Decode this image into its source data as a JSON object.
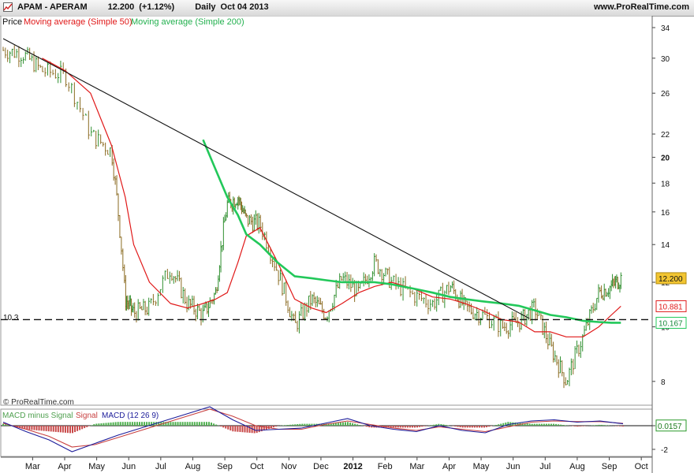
{
  "header": {
    "instrument": "APAM - APERAM",
    "last": "12.200",
    "change": "(+1.12%)",
    "period": "Daily",
    "date": "Oct 04 2013",
    "source": "www.ProRealTime.com"
  },
  "legend": {
    "price_label": "Price",
    "ma50_label": "Moving average (Simple 50)",
    "ma200_label": "Moving average (Simple 200)"
  },
  "macd_legend": {
    "hist_label": "MACD minus Signal",
    "signal_label": "Signal",
    "macd_label": "MACD (12 26 9)"
  },
  "watermark": "© ProRealTime.com",
  "support_label": "10.3",
  "colors": {
    "price": "#2f8f2f",
    "price_down": "#8a6a20",
    "ma50": "#e01818",
    "ma200": "#22c85a",
    "trendline": "#111111",
    "macd": "#1c1c9a",
    "signal": "#c84040",
    "hist_pos": "#4fb04f",
    "hist_neg": "#c84848"
  },
  "chart_data": [
    {
      "type": "line",
      "title": "APAM - APERAM",
      "scale": "log",
      "x": [
        "2011-02-01",
        "2011-02-20",
        "2011-03-10",
        "2011-04-01",
        "2011-04-25",
        "2011-05-15",
        "2011-05-28",
        "2011-06-05",
        "2011-06-20",
        "2011-07-10",
        "2011-07-26",
        "2011-08-10",
        "2011-08-22",
        "2011-09-02",
        "2011-09-12",
        "2011-09-20",
        "2011-10-03",
        "2011-10-20",
        "2011-11-05",
        "2011-11-21",
        "2011-12-05",
        "2011-12-20",
        "2012-01-05",
        "2012-01-20",
        "2012-02-05",
        "2012-02-25",
        "2012-03-15",
        "2012-04-01",
        "2012-04-15",
        "2012-05-01",
        "2012-05-20",
        "2012-06-05",
        "2012-06-20",
        "2012-07-05",
        "2012-07-20",
        "2012-08-05",
        "2012-08-20",
        "2012-09-01",
        "2012-09-10"
      ],
      "series": [
        {
          "name": "Price",
          "values": [
            31.0,
            30.5,
            28.5,
            28.0,
            22.0,
            20.5,
            11.2,
            10.6,
            10.8,
            12.7,
            11.0,
            10.5,
            11.5,
            16.5,
            17.0,
            15.5,
            15.2,
            12.5,
            10.0,
            11.2,
            10.5,
            12.2,
            11.5,
            13.0,
            12.0,
            11.4,
            11.0,
            11.8,
            10.8,
            10.5,
            10.0,
            10.2,
            10.8,
            9.2,
            8.0,
            9.6,
            11.5,
            11.8,
            12.2
          ]
        },
        {
          "name": "Moving average (Simple 50)",
          "values": [
            null,
            null,
            30.0,
            28.5,
            26.0,
            21.0,
            17.0,
            14.0,
            12.0,
            11.0,
            10.8,
            11.0,
            11.2,
            11.5,
            13.0,
            14.5,
            15.0,
            13.0,
            11.2,
            10.8,
            10.6,
            11.0,
            11.5,
            11.8,
            12.0,
            11.7,
            11.3,
            11.2,
            11.0,
            10.7,
            10.3,
            10.2,
            9.8,
            9.8,
            9.6,
            9.6,
            10.0,
            10.5,
            10.88
          ]
        },
        {
          "name": "Moving average (Simple 200)",
          "values": [
            null,
            null,
            null,
            null,
            null,
            null,
            null,
            null,
            null,
            null,
            null,
            21.5,
            19.0,
            17.0,
            15.8,
            14.6,
            14.0,
            13.0,
            12.3,
            12.2,
            12.1,
            12.0,
            12.0,
            12.0,
            11.9,
            11.7,
            11.5,
            11.3,
            11.2,
            11.1,
            11.0,
            10.9,
            10.7,
            10.5,
            10.4,
            10.25,
            10.2,
            10.17,
            10.17
          ]
        }
      ],
      "trendline": {
        "from": {
          "x": "2011-02-01",
          "y": 32.5
        },
        "to": {
          "x": "2012-06-15",
          "y": 10.35
        }
      },
      "support_line": {
        "y": 10.3
      },
      "current_value_labels": {
        "price": 12.2,
        "ma50": 10.881,
        "ma200": 10.167
      },
      "ylim": [
        7.4,
        35.0
      ],
      "y_ticks": [
        8,
        10,
        12,
        14,
        16,
        18,
        20,
        22,
        26,
        30,
        34
      ],
      "x_tick_labels": [
        "Mar",
        "Apr",
        "May",
        "Jun",
        "Jul",
        "Aug",
        "Sep",
        "Oct",
        "Nov",
        "Dec",
        "2012",
        "Feb",
        "Mar",
        "Apr",
        "May",
        "Jun",
        "Jul",
        "Aug",
        "Sep",
        "Oct"
      ],
      "grid": false,
      "legend": "top-left"
    },
    {
      "type": "line",
      "title": "MACD (12 26 9)",
      "series": [
        {
          "name": "MACD",
          "values": [
            0.3,
            -0.5,
            -1.2,
            -2.2,
            -1.5,
            -0.8,
            -0.2,
            0.4,
            1.0,
            1.6,
            0.5,
            -0.4,
            -0.3,
            -0.2,
            0.2,
            0.6,
            0.0,
            -0.3,
            -0.5,
            0.0,
            -0.4,
            -0.6,
            0.1,
            0.4,
            0.5,
            0.3,
            0.4,
            0.157
          ]
        },
        {
          "name": "Signal",
          "values": [
            0.2,
            -0.3,
            -0.9,
            -1.8,
            -1.6,
            -1.0,
            -0.4,
            0.2,
            0.8,
            1.4,
            0.8,
            0.0,
            -0.3,
            -0.3,
            0.1,
            0.4,
            0.1,
            -0.2,
            -0.4,
            -0.1,
            -0.3,
            -0.5,
            -0.1,
            0.3,
            0.4,
            0.35,
            0.35,
            0.2
          ]
        }
      ],
      "current_value_label": 0.0157,
      "ylim": [
        -2.4,
        1.2
      ],
      "y_ticks": [
        0,
        -2
      ]
    }
  ]
}
